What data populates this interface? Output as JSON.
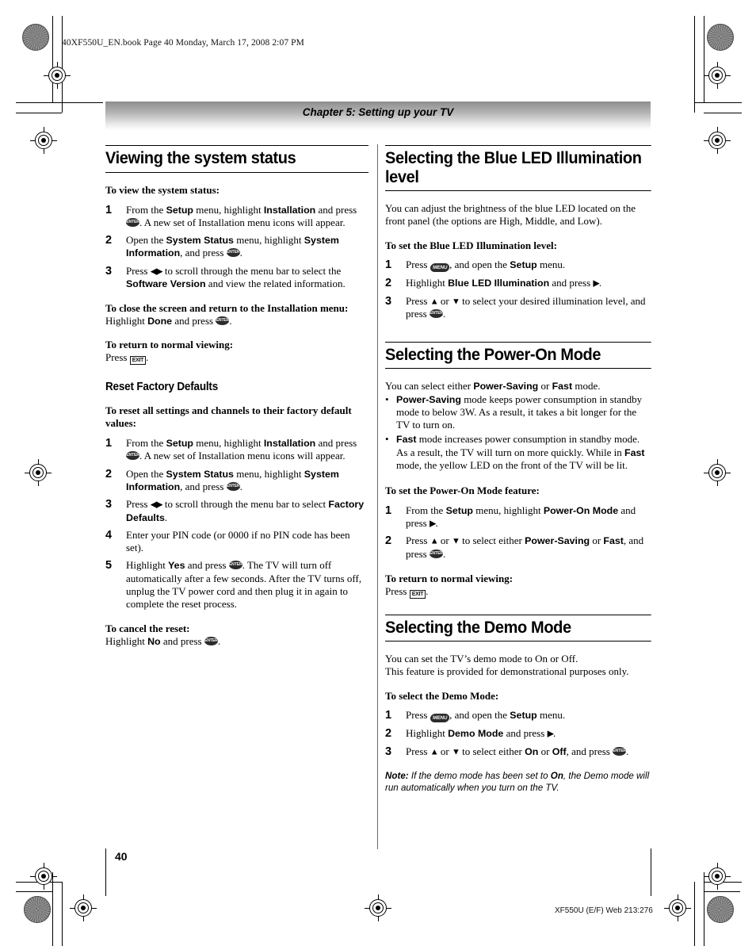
{
  "printer_marks": {
    "filestamp": "40XF550U_EN.book  Page 40  Monday, March 17, 2008  2:07 PM"
  },
  "chapter": {
    "title": "Chapter 5: Setting up your TV"
  },
  "page": {
    "number": "40",
    "footer": "XF550U (E/F) Web 213:276"
  },
  "icons": {
    "enter": "ENTER",
    "menu": "MENU",
    "exit": "EXIT",
    "left_right": "◀▶",
    "right": "▶",
    "up": "▲",
    "down": "▼",
    "bullet": "•"
  },
  "left_column": {
    "section1": {
      "heading": "Viewing the system status",
      "lead1": "To view the system status:",
      "steps1": [
        {
          "num": "1",
          "pre": "From the ",
          "b1": "Setup",
          "mid": " menu, highlight ",
          "b2": "Installation",
          "post": " and press ",
          "icon": "enter",
          "tail": ". A new set of Installation menu icons will appear."
        },
        {
          "num": "2",
          "pre": "Open the ",
          "b1": "System Status",
          "mid": " menu, highlight ",
          "b2": "System Information",
          "post": ", and press ",
          "icon": "enter",
          "tail": "."
        },
        {
          "num": "3",
          "pre": "Press ",
          "arrows": "◀▶",
          "mid": " to scroll through the menu bar to select the ",
          "b2": "Software Version",
          "tail": " and view the related information."
        }
      ],
      "lead2": "To close the screen and return to the Installation menu:",
      "para2_pre": "Highlight ",
      "para2_b": "Done",
      "para2_post": " and press ",
      "para2_tail": ".",
      "lead3": "To return to normal viewing:",
      "para3_pre": "Press ",
      "para3_tail": "."
    },
    "section2": {
      "subheading": "Reset Factory Defaults",
      "lead1": "To reset all settings and channels to their factory default values:",
      "steps": [
        {
          "num": "1",
          "pre": "From the ",
          "b1": "Setup",
          "mid": " menu, highlight ",
          "b2": "Installation",
          "post": " and press ",
          "tail": ". A new set of Installation menu icons will appear."
        },
        {
          "num": "2",
          "pre": "Open the ",
          "b1": "System Status",
          "mid": " menu, highlight ",
          "b2": "System Information",
          "post": ", and press ",
          "tail": "."
        },
        {
          "num": "3",
          "pre": "Press ",
          "arrows": "◀▶",
          "mid": " to scroll through the menu bar to select ",
          "b2": "Factory Defaults",
          "tail": "."
        },
        {
          "num": "4",
          "plain": "Enter your PIN code (or 0000 if no PIN code has been set)."
        },
        {
          "num": "5",
          "pre": "Highlight ",
          "b1": "Yes",
          "post": " and press ",
          "tail": ". The TV will turn off automatically after a few seconds. After the TV turns off, unplug the TV power cord and then plug it in again to complete the reset process."
        }
      ],
      "lead2": "To cancel the reset:",
      "para_pre": "Highlight ",
      "para_b": "No",
      "para_post": " and press ",
      "para_tail": "."
    }
  },
  "right_column": {
    "section1": {
      "heading": "Selecting the Blue LED Illumination level",
      "intro": "You can adjust the brightness of the blue LED located on the front panel (the options are High, Middle, and Low).",
      "lead": "To set the Blue LED Illumination level:",
      "steps": [
        {
          "num": "1",
          "pre": "Press ",
          "post": ", and open the ",
          "b2": "Setup",
          "tail": " menu."
        },
        {
          "num": "2",
          "pre": "Highlight ",
          "b1": "Blue LED Illumination",
          "post": " and press ",
          "tail": "."
        },
        {
          "num": "3",
          "pre": "Press ",
          "mid": " or ",
          "post": " to select your desired illumination level, and press ",
          "tail": "."
        }
      ]
    },
    "section2": {
      "heading": "Selecting the Power-On Mode",
      "intro_pre": "You can select either ",
      "intro_b1": "Power-Saving",
      "intro_mid": " or ",
      "intro_b2": "Fast",
      "intro_post": " mode.",
      "bullets": [
        {
          "b": "Power-Saving",
          "text": " mode keeps power consumption in standby mode to below 3W. As a result, it takes a bit longer for the TV to turn on."
        },
        {
          "b": "Fast",
          "text": " mode increases power consumption in standby mode. As a result, the TV will turn on more quickly. While in ",
          "b2": "Fast",
          "text2": " mode, the yellow LED on the front of the TV will be lit."
        }
      ],
      "lead": "To set the Power-On Mode feature:",
      "steps": [
        {
          "num": "1",
          "pre": "From the ",
          "b1": "Setup",
          "mid": " menu, highlight ",
          "b2": "Power-On Mode",
          "post": " and press ",
          "tail": "."
        },
        {
          "num": "2",
          "pre": "Press ",
          "mid": " or ",
          "post": " to select either ",
          "b1": "Power-Saving",
          "mid2": " or ",
          "b2": "Fast",
          "post2": ", and press ",
          "tail": "."
        }
      ],
      "lead2": "To return to normal viewing:",
      "para_pre": "Press ",
      "para_tail": "."
    },
    "section3": {
      "heading": "Selecting the Demo Mode",
      "intro1": "You can set the TV’s demo mode to On or Off.",
      "intro2": "This feature is provided for demonstrational purposes only.",
      "lead": "To select the Demo Mode:",
      "steps": [
        {
          "num": "1",
          "pre": "Press ",
          "post": ", and open the ",
          "b2": "Setup",
          "tail": " menu."
        },
        {
          "num": "2",
          "pre": "Highlight ",
          "b1": "Demo Mode",
          "post": " and press ",
          "tail": "."
        },
        {
          "num": "3",
          "pre": "Press ",
          "mid": " or ",
          "post": " to select either ",
          "b1": "On",
          "mid2": " or ",
          "b2": "Off",
          "post2": ", and press ",
          "tail": "."
        }
      ],
      "note_label": "Note:",
      "note_pre": " If the demo mode has been set to ",
      "note_b": "On",
      "note_post": ", the Demo mode will run automatically when you turn on the TV."
    }
  }
}
